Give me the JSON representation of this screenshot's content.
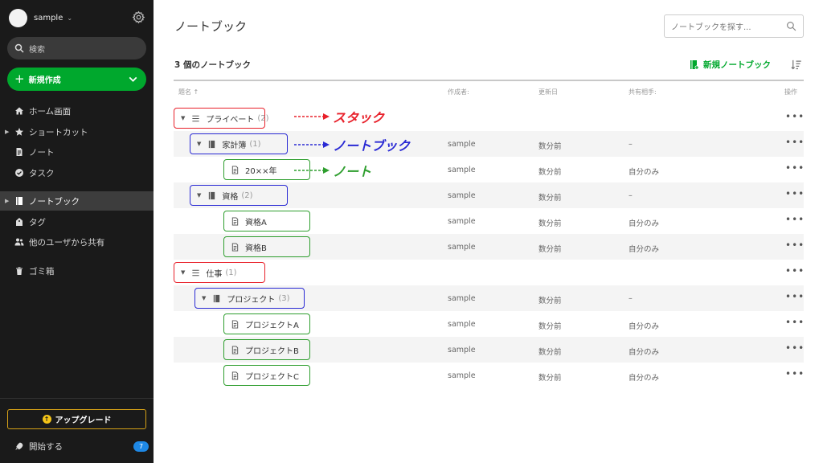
{
  "sidebar": {
    "account_name": "sample",
    "search_placeholder": "検索",
    "new_button_label": "新規作成",
    "nav": [
      {
        "label": "ホーム画面",
        "icon": "home-icon"
      },
      {
        "label": "ショートカット",
        "icon": "star-icon"
      },
      {
        "label": "ノート",
        "icon": "note-icon"
      },
      {
        "label": "タスク",
        "icon": "check-circle-icon"
      },
      {
        "label": "ノートブック",
        "icon": "notebook-icon"
      },
      {
        "label": "タグ",
        "icon": "tag-icon"
      },
      {
        "label": "他のユーザから共有",
        "icon": "people-icon"
      },
      {
        "label": "ゴミ箱",
        "icon": "trash-icon"
      }
    ],
    "upgrade_label": "アップグレード",
    "start_label": "開始する",
    "start_badge": "7"
  },
  "main": {
    "title": "ノートブック",
    "search_placeholder": "ノートブックを探す...",
    "count_label": "3 個のノートブック",
    "new_notebook_label": "新規ノートブック",
    "columns": {
      "title": "題名 ↑",
      "author": "作成者:",
      "updated": "更新日",
      "shared": "共有相手:",
      "actions": "操作"
    },
    "rows": [
      {
        "type": "stack",
        "name": "プライベート",
        "count": "(2)",
        "author": "",
        "updated": "",
        "shared": "",
        "more": "•••"
      },
      {
        "type": "notebook",
        "name": "家計簿",
        "count": "(1)",
        "author": "sample",
        "updated": "数分前",
        "shared": "–",
        "more": "•••"
      },
      {
        "type": "note",
        "name": "20××年",
        "count": "",
        "author": "sample",
        "updated": "数分前",
        "shared": "自分のみ",
        "more": "•••"
      },
      {
        "type": "notebook",
        "name": "資格",
        "count": "(2)",
        "author": "sample",
        "updated": "数分前",
        "shared": "–",
        "more": "•••"
      },
      {
        "type": "note",
        "name": "資格A",
        "count": "",
        "author": "sample",
        "updated": "数分前",
        "shared": "自分のみ",
        "more": "•••"
      },
      {
        "type": "note",
        "name": "資格B",
        "count": "",
        "author": "sample",
        "updated": "数分前",
        "shared": "自分のみ",
        "more": "•••"
      },
      {
        "type": "stack",
        "name": "仕事",
        "count": "(1)",
        "author": "",
        "updated": "",
        "shared": "",
        "more": "•••"
      },
      {
        "type": "notebook",
        "name": "プロジェクト",
        "count": "(3)",
        "author": "sample",
        "updated": "数分前",
        "shared": "–",
        "more": "•••"
      },
      {
        "type": "note",
        "name": "プロジェクトA",
        "count": "",
        "author": "sample",
        "updated": "数分前",
        "shared": "自分のみ",
        "more": "•••"
      },
      {
        "type": "note",
        "name": "プロジェクトB",
        "count": "",
        "author": "sample",
        "updated": "数分前",
        "shared": "自分のみ",
        "more": "•••"
      },
      {
        "type": "note",
        "name": "プロジェクトC",
        "count": "",
        "author": "sample",
        "updated": "数分前",
        "shared": "自分のみ",
        "more": "•••"
      }
    ]
  },
  "annotations": {
    "stack": "スタック",
    "notebook": "ノートブック",
    "note": "ノート"
  },
  "colors": {
    "sidebar_bg": "#1a1a1a",
    "accent_green": "#00a82d",
    "stack_red": "#e8202a",
    "notebook_blue": "#2a2ad4",
    "note_green": "#2e9e2e",
    "upgrade_gold": "#d4a017",
    "badge_blue": "#1e88e5"
  }
}
